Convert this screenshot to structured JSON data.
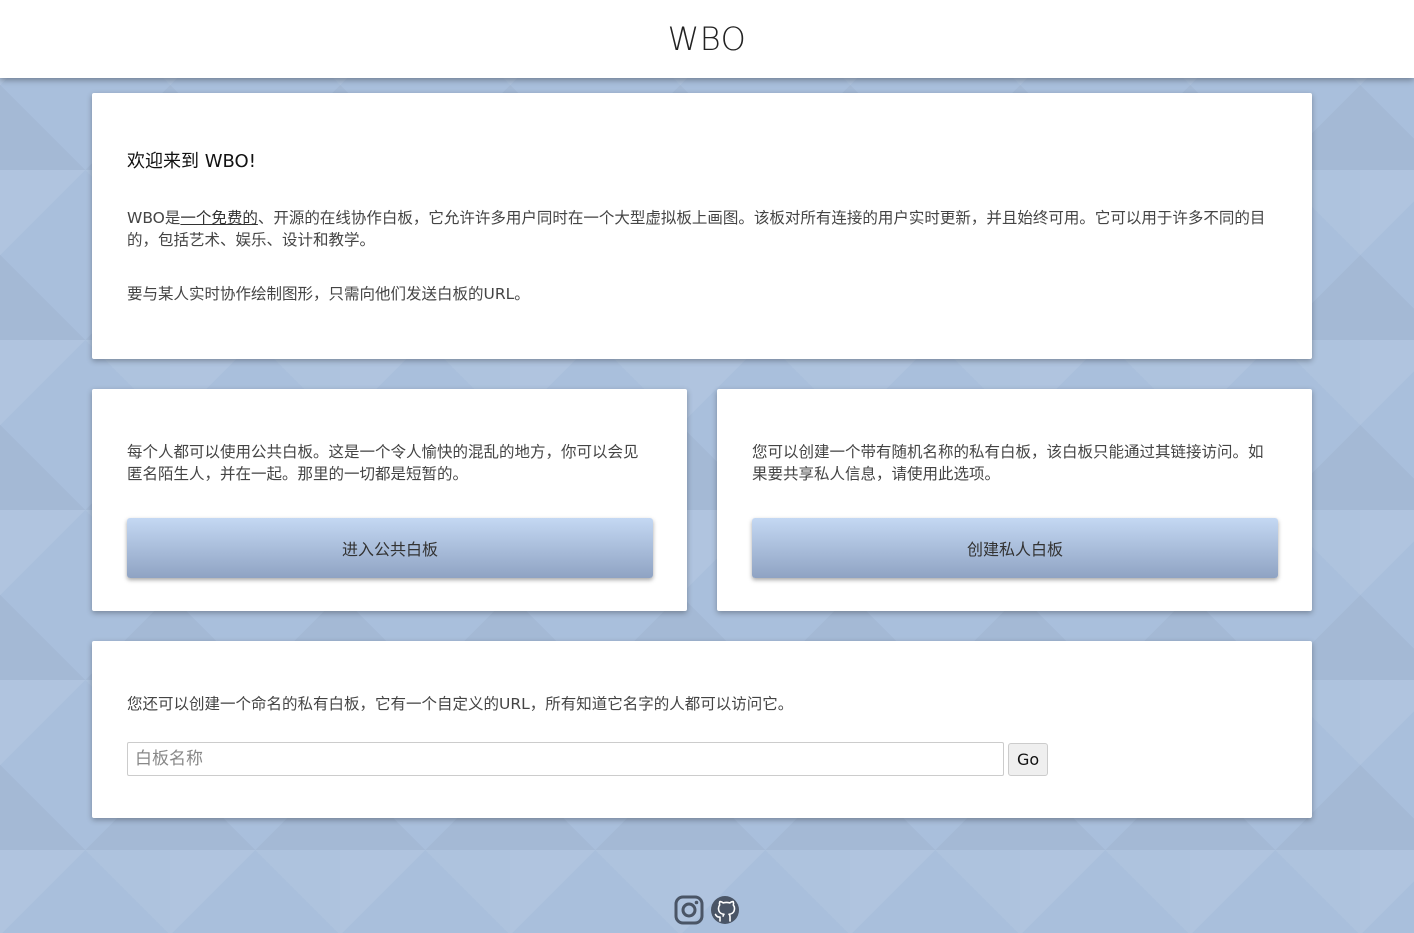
{
  "header": {
    "title": "WBO"
  },
  "welcome": {
    "title": "欢迎来到 WBO!",
    "p1_pre": "WBO是",
    "p1_link": "一个免费的",
    "p1_post": "、开源的在线协作白板，它允许许多用户同时在一个大型虚拟板上画图。该板对所有连接的用户实时更新，并且始终可用。它可以用于许多不同的目的，包括艺术、娱乐、设计和教学。",
    "p2": "要与某人实时协作绘制图形，只需向他们发送白板的URL。"
  },
  "public_board": {
    "text": "每个人都可以使用公共白板。这是一个令人愉快的混乱的地方，你可以会见匿名陌生人，并在一起。那里的一切都是短暂的。",
    "button_label": "进入公共白板"
  },
  "private_board": {
    "text": "您可以创建一个带有随机名称的私有白板，该白板只能通过其链接访问。如果要共享私人信息，请使用此选项。",
    "button_label": "创建私人白板"
  },
  "named_board": {
    "text": "您还可以创建一个命名的私有白板，它有一个自定义的URL，所有知道它名字的人都可以访问它。",
    "input_placeholder": "白板名称",
    "input_value": "",
    "go_label": "Go"
  },
  "footer": {
    "icons": [
      "instagram-icon",
      "github-icon"
    ],
    "icon_color": "#4a5566"
  },
  "colors": {
    "background": "#a9bfdc",
    "button_top": "#c4d8f3",
    "button_bottom": "#8fa3c3"
  }
}
